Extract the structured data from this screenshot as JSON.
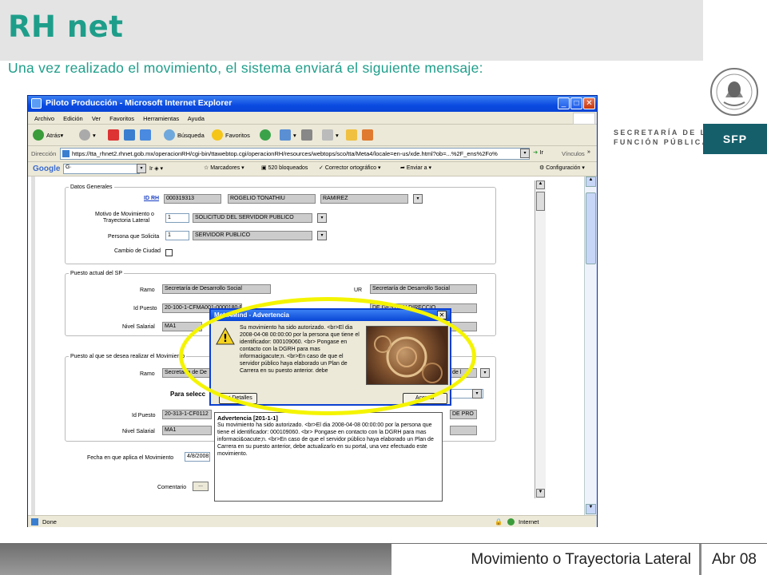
{
  "slide": {
    "title": "RH net",
    "subtitle": "Una vez realizado el movimiento, el sistema enviará el siguiente mensaje:",
    "secretaria_line1": "SECRETARÍA DE LA",
    "secretaria_line2": "FUNCIÓN PÚBLICA",
    "sfp": "SFP",
    "footer_title": "Movimiento o Trayectoria Lateral",
    "footer_date": "Abr 08"
  },
  "browser": {
    "window_title": "Piloto Producción - Microsoft Internet Explorer",
    "menu": [
      "Archivo",
      "Edición",
      "Ver",
      "Favoritos",
      "Herramientas",
      "Ayuda"
    ],
    "toolbar": {
      "back": "Atrás",
      "search": "Búsqueda",
      "favorites": "Favoritos"
    },
    "address_label": "Dirección",
    "address_url": "https://tta_rhnet2.rhnet.gob.mx/operacionRH/cgi-bin/ttawebtop.cgi/operacionRH/resources/webtops/sco/tta/Meta4/locale=en-us/xde.html?ob=...%2F_ens%2Fo%",
    "go_label": "Ir",
    "links_label": "Vínculos",
    "google": {
      "logo": "Google",
      "go": "Ir",
      "bookmarks": "Marcadores",
      "blocked": "520 bloqueados",
      "spell": "Corrector ortográfico",
      "send": "Enviar a",
      "settings": "Configuración"
    },
    "status": {
      "left": "Done",
      "zone": "Internet"
    }
  },
  "form": {
    "datos_generales": {
      "legend": "Datos Generales",
      "id_rh_label": "ID RH",
      "id_rh": "000319313",
      "nombre": "ROGELIO TONATHIU",
      "apellido": "RAMIREZ",
      "motivo_label_1": "Motivo  de Movimiento o",
      "motivo_label_2": "Trayectoria Lateral",
      "motivo_code": "1",
      "motivo_value": "SOLICITUD DEL SERVIDOR PUBLICO",
      "persona_label": "Persona que Solicita",
      "persona_code": "1",
      "persona_value": "SERVIDOR PUBLICO",
      "cambio_label": "Cambio de Ciudad"
    },
    "puesto_actual": {
      "legend": "Puesto actual del SP",
      "ramo_label": "Ramo",
      "ramo": "Secretaría de Desarrollo Social",
      "ur_label": "UR",
      "ur": "Secretaría de Desarrollo Social",
      "id_puesto_label": "Id Puesto",
      "id_puesto": "20-100-1-CFMA001-0000180-E",
      "puesto_desc": "DE GESTION DIRECCIO",
      "nivel_label": "Nivel Salarial",
      "nivel": "MA1"
    },
    "puesto_nuevo": {
      "legend": "Puesto al que se desea realizar el Movimiento",
      "ramo_label": "Ramo",
      "ramo": "Secretaría de De",
      "ramo_right": "de l",
      "para_label": "Para selecc",
      "id_puesto_label": "Id Puesto",
      "id_puesto": "20-313-1-CF0112",
      "puesto_desc": "DE PRO",
      "nivel_label": "Nivel Salarial",
      "nivel": "MA1"
    },
    "fecha_label": "Fecha en que aplica el Movimiento",
    "fecha": "4/8/2008",
    "comentario_label": "Comentario",
    "comentario_btn": "..."
  },
  "dialog": {
    "title": "Meta4Mind - Advertencia",
    "message": "Su movimiento ha sido autorizado. <br>El dia 2008-04-08 00:00:00 por la persona que tiene el identificador: 000109060. <br> Pongase en contacto con la DGRH para mas informacigacute;n. <br>En caso de que el servidor público haya elaborado un Plan de Carrera en su puesto anterior. debe",
    "details_btn": "<< Detalles",
    "accept_btn": "Aceptar",
    "detail_heading": "Advertencia [201-1-1]",
    "detail_text": "Su movimiento ha sido autorizado. <br>El dia 2008-04-08 00:00:00 por la persona que tiene el identificador: 000109060. <br> Pongase en contacto con la DGRH para mas informaci&oacute;n. <br>En caso de que el servidor público haya elaborado un Plan de Carrera en su puesto anterior, debe actualizarlo en su portal, una vez efectuado este movimiento."
  }
}
